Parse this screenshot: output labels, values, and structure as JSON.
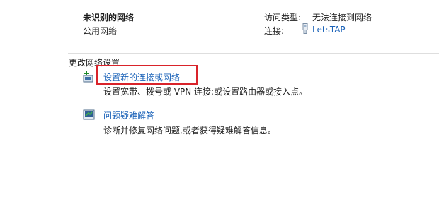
{
  "network": {
    "name": "未识别的网络",
    "type": "公用网络"
  },
  "access": {
    "type_label": "访问类型:",
    "type_value": "无法连接到网络",
    "connection_label": "连接:",
    "connection_value": "LetsTAP"
  },
  "section": {
    "title": "更改网络设置"
  },
  "actions": [
    {
      "title": "设置新的连接或网络",
      "description": "设置宽带、拨号或 VPN 连接;或设置路由器或接入点。",
      "icon": "new-connection-icon"
    },
    {
      "title": "问题疑难解答",
      "description": "诊断并修复网络问题,或者获得疑难解答信息。",
      "icon": "troubleshoot-icon"
    }
  ],
  "colors": {
    "link": "#1a62b8",
    "highlight_border": "#d9232a"
  }
}
